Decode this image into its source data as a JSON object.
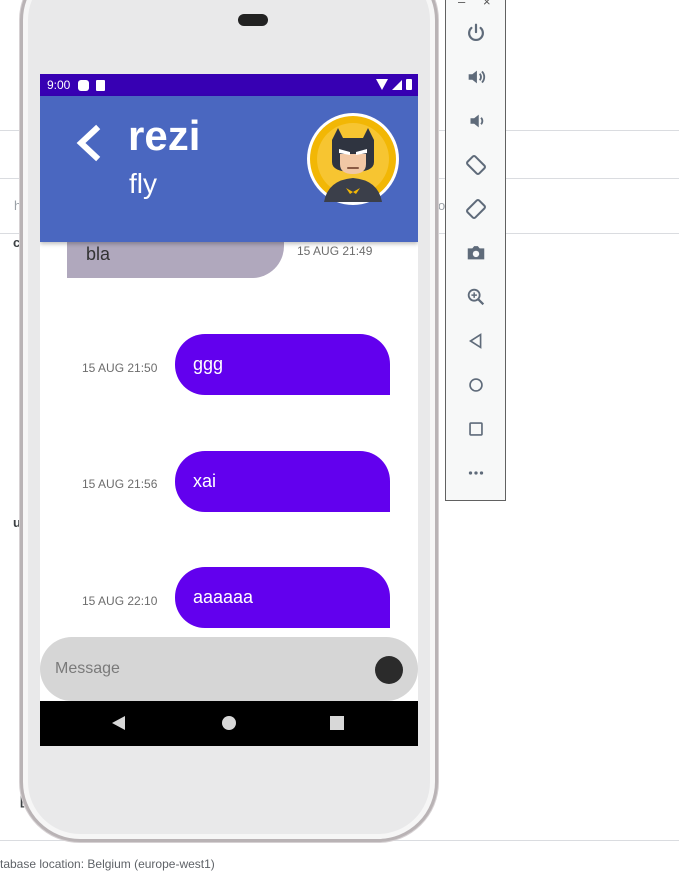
{
  "background": {
    "footer_text": "tabase location: Belgium (europe-west1)",
    "chars": {
      "c": "c",
      "h": "h",
      "u": "u",
      "o": "o",
      "bracket": "["
    }
  },
  "status_bar": {
    "time": "9:00"
  },
  "chat_header": {
    "name": "rezi",
    "status": "fly",
    "avatar_icon": "batman-avatar-icon",
    "back_icon": "chevron-left-icon"
  },
  "messages": [
    {
      "direction": "incoming",
      "text": "bla",
      "timestamp": "15 AUG 21:49"
    },
    {
      "direction": "outgoing",
      "text": "ggg",
      "timestamp": "15 AUG 21:50"
    },
    {
      "direction": "outgoing",
      "text": "xai",
      "timestamp": "15 AUG 21:56"
    },
    {
      "direction": "outgoing",
      "text": "aaaaaa",
      "timestamp": "15 AUG 22:10"
    }
  ],
  "composer": {
    "placeholder": "Message",
    "value": ""
  },
  "emulator_toolbar": {
    "minimize_label": "–",
    "close_label": "×",
    "buttons": [
      "power-icon",
      "volume-up-icon",
      "volume-down-icon",
      "rotate-left-icon",
      "rotate-right-icon",
      "camera-icon",
      "zoom-icon",
      "back-icon",
      "home-icon",
      "overview-icon",
      "more-icon"
    ]
  },
  "colors": {
    "status_bar": "#3700b3",
    "app_bar": "#4a67c0",
    "outgoing_bubble": "#6200ee",
    "incoming_bubble": "#b0a8bd",
    "composer": "#d6d6d6"
  }
}
